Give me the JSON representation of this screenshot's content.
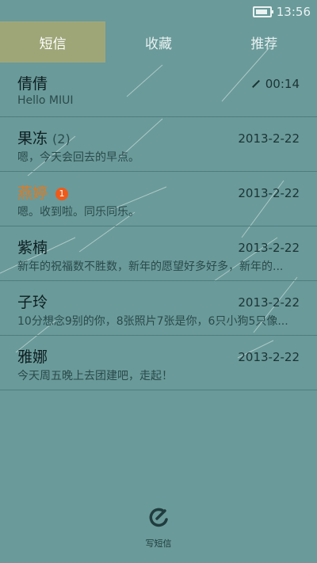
{
  "statusbar": {
    "time": "13:56"
  },
  "tabs": [
    {
      "label": "短信",
      "active": true
    },
    {
      "label": "收藏",
      "active": false
    },
    {
      "label": "推荐",
      "active": false
    }
  ],
  "conversations": [
    {
      "name": "倩倩",
      "count": "",
      "badge": "",
      "time": "00:14",
      "preview": "Hello MIUI",
      "draft": true
    },
    {
      "name": "果冻",
      "count": "(2)",
      "badge": "",
      "time": "2013-2-22",
      "preview": "嗯，今天会回去的早点。"
    },
    {
      "name": "燕婷",
      "count": "",
      "badge": "1",
      "time": "2013-2-22",
      "preview": "嗯。收到啦。同乐同乐。",
      "unread": true
    },
    {
      "name": "紫楠",
      "count": "",
      "badge": "",
      "time": "2013-2-22",
      "preview": "新年的祝福数不胜数，新年的愿望好多好多，新年的..."
    },
    {
      "name": "子玲",
      "count": "",
      "badge": "",
      "time": "2013-2-22",
      "preview": "10分想念9别的你，8张照片7张是你，6只小狗5只像..."
    },
    {
      "name": "雅娜",
      "count": "",
      "badge": "",
      "time": "2013-2-22",
      "preview": "今天周五晚上去团建吧，走起！"
    }
  ],
  "compose": {
    "label": "写短信",
    "icon": "compose-icon"
  }
}
